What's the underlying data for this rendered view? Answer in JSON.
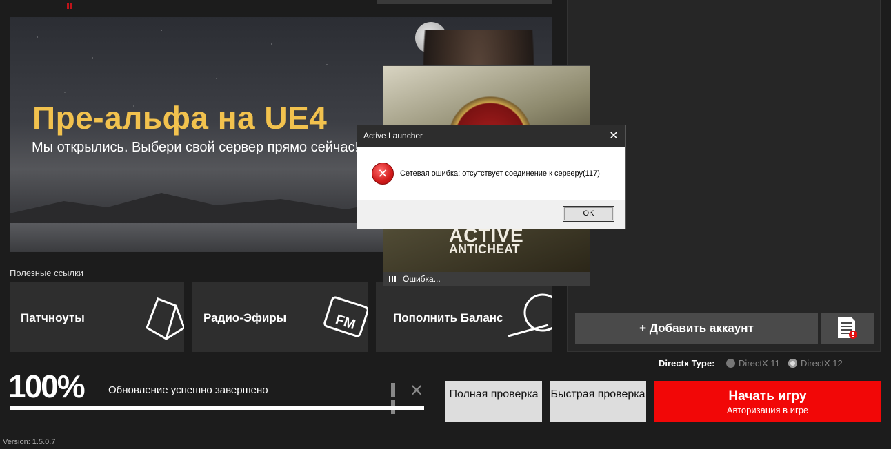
{
  "banner": {
    "title": "Пре-альфа на UE4",
    "subtitle": "Мы открылись. Выбери свой сервер прямо сейчас!"
  },
  "links": {
    "label": "Полезные ссылки",
    "items": [
      {
        "label": "Патчноуты",
        "icon": "book-icon"
      },
      {
        "label": "Радио-Эфиры",
        "icon": "fm-radio-icon"
      },
      {
        "label": "Пополнить Баланс",
        "icon": "wallet-icon"
      }
    ]
  },
  "splash": {
    "brand_line1": "ACTIVE",
    "brand_line2": "ANTICHEAT",
    "status": "Ошибка..."
  },
  "dialog": {
    "title": "Active Launcher",
    "close": "✕",
    "icon_glyph": "✕",
    "message": "Сетевая ошибка: отсутствует соединение к серверу(117)",
    "ok_label": "OK"
  },
  "accounts": {
    "add_label": "+  Добавить аккаунт"
  },
  "directx": {
    "label": "Directx Type:",
    "options": [
      {
        "label": "DirectX 11",
        "selected": false
      },
      {
        "label": "DirectX 12",
        "selected": true
      }
    ]
  },
  "update": {
    "percent_text": "100%",
    "progress": 1.0,
    "status": "Обновление успешно завершено",
    "cancel_glyph": "✕"
  },
  "actions": {
    "full_check": "Полная проверка",
    "quick_check": "Быстрая проверка",
    "play_label": "Начать игру",
    "play_sub": "Авторизация в игре"
  },
  "version": "Version: 1.5.0.7",
  "colors": {
    "accent_red": "#f20707",
    "banner_title": "#f2c24e",
    "background": "#1c1c1c"
  }
}
